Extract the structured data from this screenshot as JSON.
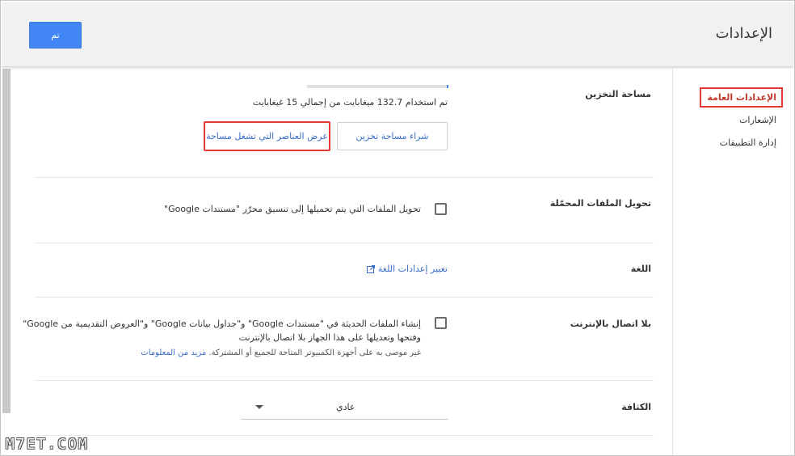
{
  "header": {
    "title": "الإعدادات",
    "done_label": "تم"
  },
  "sidebar": {
    "items": [
      {
        "label": "الإعدادات العامة",
        "active": true
      },
      {
        "label": "الإشعارات",
        "active": false
      },
      {
        "label": "إدارة التطبيقات",
        "active": false
      }
    ]
  },
  "storage": {
    "label": "مساحة التخزين",
    "usage_text": "تم استخدام 132.7 ميغابايت من إجمالي 15 غيغابايت",
    "usage_fraction": 0.009,
    "buy_button": "شراء مساحة تخزين",
    "view_button": "عرض العناصر التي تشغل مساحة"
  },
  "convert": {
    "label": "تحويل الملفات المحمّلة",
    "option_text": "تحويل الملفات التي يتم تحميلها إلى تنسيق محرّر \"مستندات Google\""
  },
  "language": {
    "label": "اللغة",
    "link_text": "تغيير إعدادات اللغة"
  },
  "offline": {
    "label": "بلا اتصال بالإنترنت",
    "line1": "إنشاء الملفات الحديثة في \"مستندات Google\" و\"جداول بيانات Google\" و\"العروض التقديمية من Google\"",
    "line2": "وفتحها وتعديلها على هذا الجهاز بلا اتصال بالإنترنت",
    "note": "غير موصى به على أجهزة الكمبيوتر المتاحة للجميع أو المشتركة.",
    "learn_more": "مزيد من المعلومات"
  },
  "density": {
    "label": "الكثافة",
    "value": "عادي"
  },
  "watermark": "M7ET.COM",
  "colors": {
    "accent": "#4285f4",
    "highlight": "#e53935",
    "link": "#3b6ec9"
  }
}
